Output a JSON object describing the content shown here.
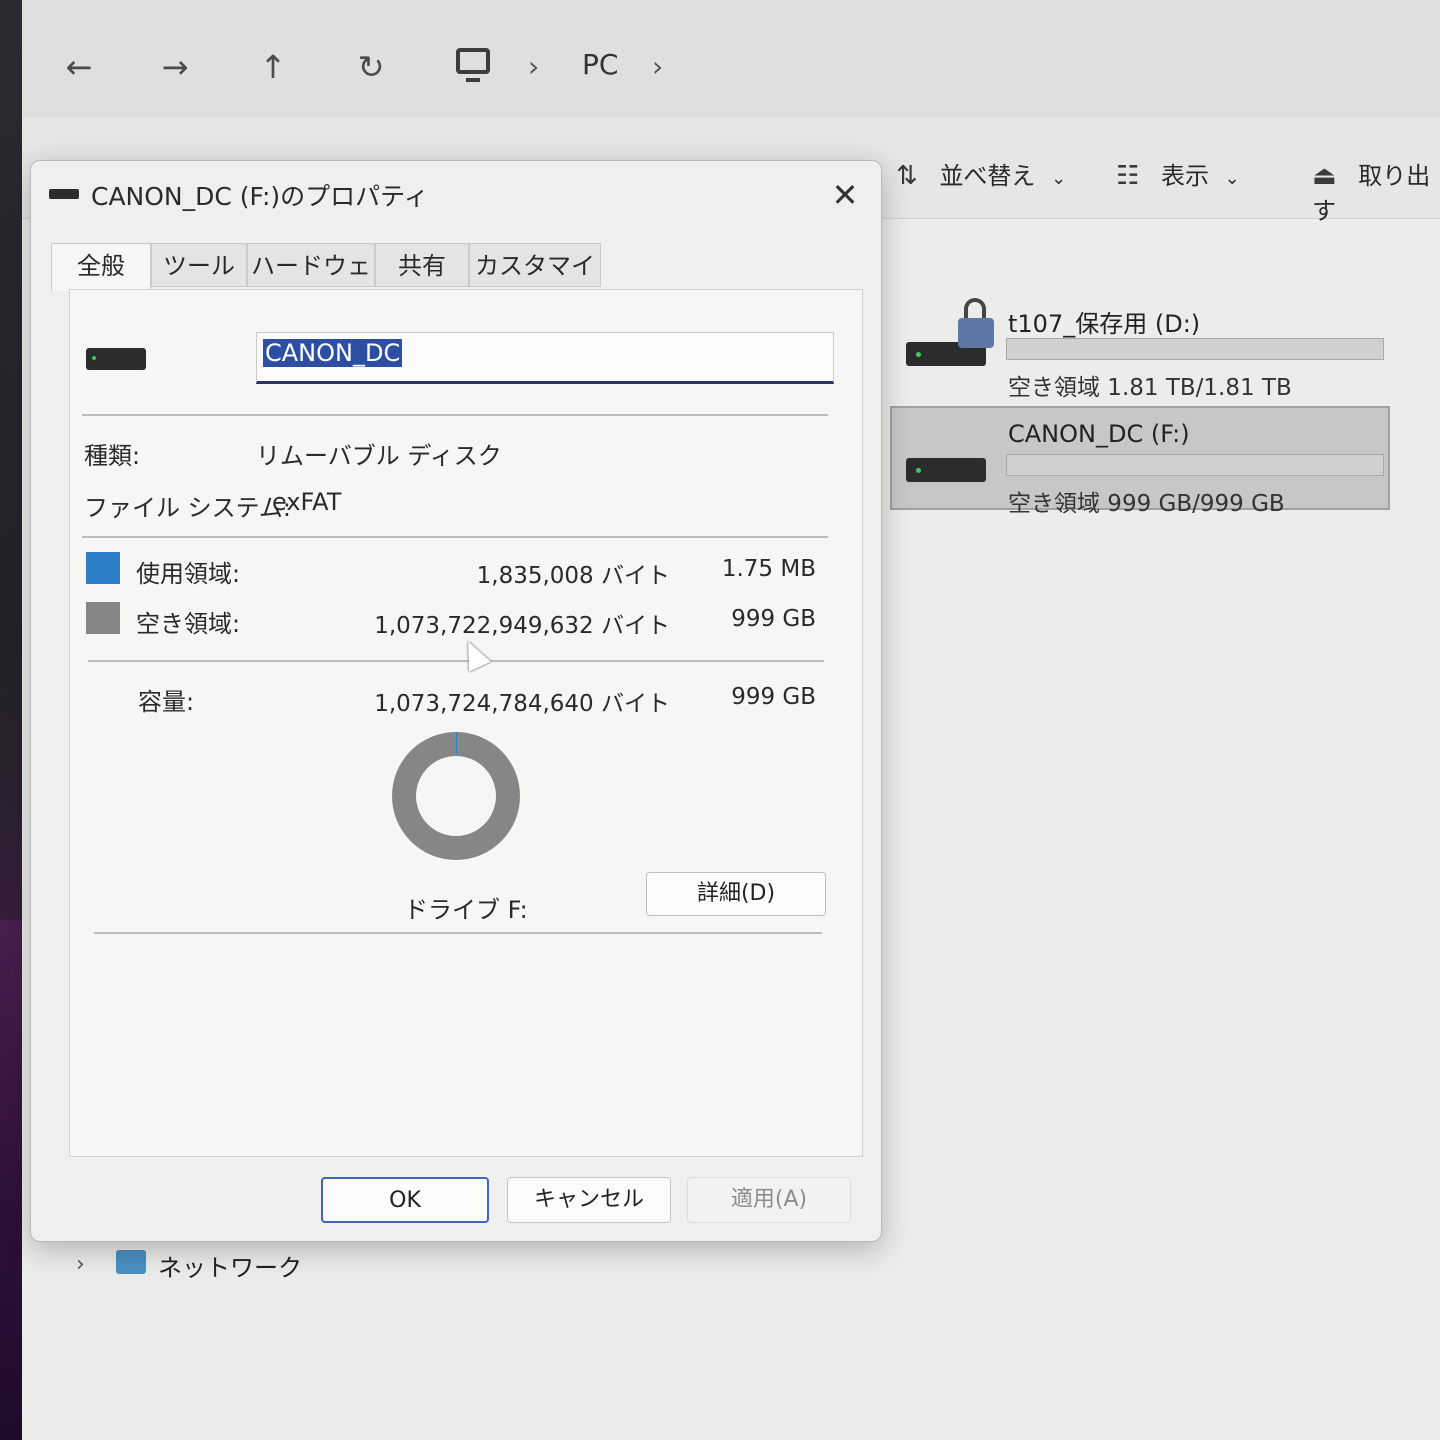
{
  "nav": {
    "back_icon": "←",
    "forward_icon": "→",
    "up_icon": "↑",
    "refresh_icon": "↻",
    "breadcrumb_chevron": "›",
    "breadcrumb_pc": "PC"
  },
  "commandbar": {
    "sort_icon": "⇅",
    "sort_label": "並べ替え",
    "view_icon": "☷",
    "view_label": "表示",
    "dropdown_icon": "⌄",
    "eject_icon": "⏏",
    "eject_label": "取り出す"
  },
  "drives": [
    {
      "name": "t107_保存用 (D:)",
      "free_text": "空き領域 1.81 TB/1.81 TB",
      "used_fraction": 0.0,
      "locked": true
    },
    {
      "name": "CANON_DC (F:)",
      "free_text": "空き領域 999 GB/999 GB",
      "used_fraction": 0.0,
      "selected": true
    }
  ],
  "sidebar": {
    "network_chevron": "›",
    "network_label": "ネットワーク"
  },
  "dialog": {
    "title": "CANON_DC (F:)のプロパティ",
    "close_icon": "✕",
    "tabs": [
      "全般",
      "ツール",
      "ハードウェア",
      "共有",
      "カスタマイズ"
    ],
    "volume_name": "CANON_DC",
    "type_label": "種類:",
    "type_value": "リムーバブル ディスク",
    "fs_label": "ファイル システム:",
    "fs_value": "exFAT",
    "used_label": "使用領域:",
    "used_bytes": "1,835,008 バイト",
    "used_size": "1.75 MB",
    "free_label": "空き領域:",
    "free_bytes": "1,073,722,949,632 バイト",
    "free_size": "999 GB",
    "capacity_label": "容量:",
    "capacity_bytes": "1,073,724,784,640 バイト",
    "capacity_size": "999 GB",
    "drive_label": "ドライブ F:",
    "details_button": "詳細(D)",
    "ok_button": "OK",
    "cancel_button": "キャンセル",
    "apply_button": "適用(A)",
    "used_color": "#2f7fc8",
    "free_color": "#858685"
  }
}
